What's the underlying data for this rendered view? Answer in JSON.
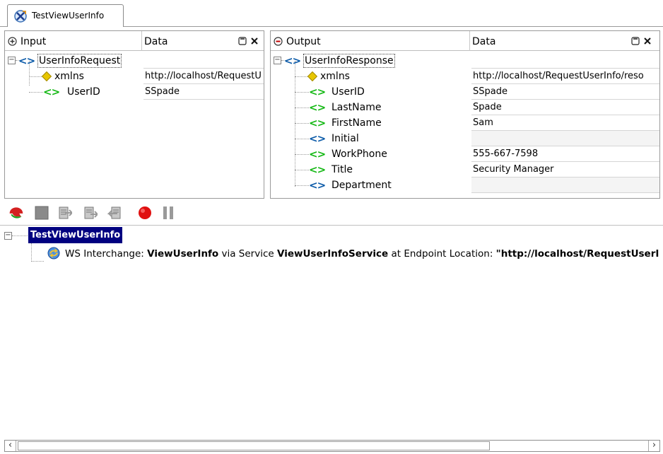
{
  "tab": {
    "title": "TestViewUserInfo"
  },
  "input_panel": {
    "header_name": "Input",
    "header_data": "Data",
    "rows": [
      {
        "name": "UserInfoRequest",
        "value": "",
        "kind": "element"
      },
      {
        "name": "xmlns",
        "value": "http://localhost/RequestU",
        "kind": "attribute"
      },
      {
        "name": "UserID",
        "value": "SSpade",
        "kind": "element"
      }
    ]
  },
  "output_panel": {
    "header_name": "Output",
    "header_data": "Data",
    "rows": [
      {
        "name": "UserInfoResponse",
        "value": "",
        "kind": "element"
      },
      {
        "name": "xmlns",
        "value": "http://localhost/RequestUserInfo/reso",
        "kind": "attribute"
      },
      {
        "name": "UserID",
        "value": "SSpade",
        "kind": "element"
      },
      {
        "name": "LastName",
        "value": "Spade",
        "kind": "element"
      },
      {
        "name": "FirstName",
        "value": "Sam",
        "kind": "element"
      },
      {
        "name": "Initial",
        "value": "",
        "kind": "element-empty"
      },
      {
        "name": "WorkPhone",
        "value": "555-667-7598",
        "kind": "element"
      },
      {
        "name": "Title",
        "value": "Security Manager",
        "kind": "element"
      },
      {
        "name": "Department",
        "value": "",
        "kind": "element-empty"
      }
    ]
  },
  "log": {
    "root_label": "TestViewUserInfo",
    "entry": {
      "prefix": "WS Interchange:",
      "operation": "ViewUserInfo",
      "via": "via Service",
      "service": "ViewUserInfoService",
      "at": "at Endpoint Location:",
      "endpoint": "\"http://localhost/RequestUserIr"
    }
  },
  "icons": [
    "run-icon",
    "stop-icon",
    "step-icon",
    "step-into-icon",
    "step-out-icon",
    "record-icon",
    "pause-icon"
  ],
  "colors": {
    "selection": "#000080",
    "element_green": "#14b814",
    "element_blue": "#0b5aa8"
  }
}
